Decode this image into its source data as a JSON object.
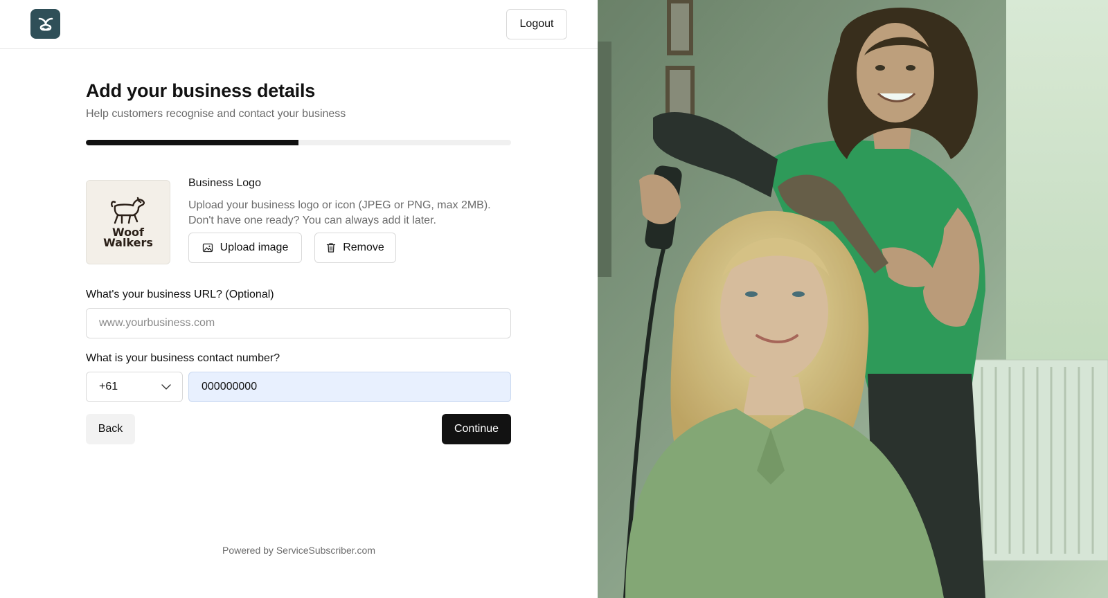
{
  "header": {
    "logout_label": "Logout"
  },
  "page": {
    "title": "Add your business details",
    "subtitle": "Help customers recognise and contact your business",
    "progress_percent": 50
  },
  "logo_section": {
    "label": "Business Logo",
    "help_line1": "Upload your business logo or icon (JPEG or PNG, max 2MB).",
    "help_line2": "Don't have one ready? You can always add it later.",
    "logo_line1": "Woof",
    "logo_line2": "Walkers",
    "upload_label": "Upload image",
    "remove_label": "Remove"
  },
  "url_field": {
    "label": "What's your business URL? (Optional)",
    "placeholder": "www.yourbusiness.com",
    "value": ""
  },
  "phone_field": {
    "label": "What is your business contact number?",
    "country_code": "+61",
    "value": "000000000"
  },
  "actions": {
    "back_label": "Back",
    "continue_label": "Continue"
  },
  "footer": {
    "text": "Powered by ServiceSubscriber.com"
  },
  "colors": {
    "primary": "#121212",
    "brand_logo_bg": "#2f4f58",
    "phone_input_bg": "#e8f0fe",
    "photo_tint": "#2e9a5a"
  },
  "icons": {
    "brand": "app-logo-icon",
    "upload": "image-icon",
    "remove": "trash-icon",
    "select": "chevron-down-icon"
  }
}
